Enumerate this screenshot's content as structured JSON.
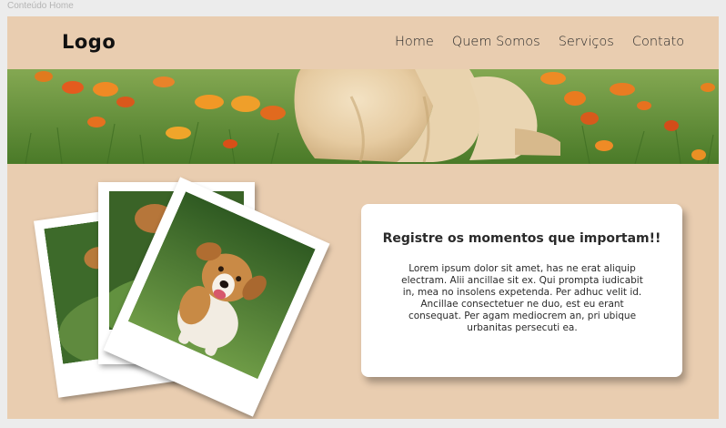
{
  "frame": {
    "label": "Conteúdo Home"
  },
  "header": {
    "logo": "Logo",
    "nav": [
      {
        "label": "Home"
      },
      {
        "label": "Quem Somos"
      },
      {
        "label": "Serviços"
      },
      {
        "label": "Contato"
      }
    ]
  },
  "card": {
    "title": "Registre os momentos que importam!!",
    "body": "Lorem ipsum dolor sit amet, has ne erat aliquip electram. Alii ancillae sit ex. Qui prompta iudicabit in, mea no insolens expetenda. Per adhuc velit id. Ancillae consectetuer ne duo, est eu erant consequat. Per agam mediocrem an, pri ubique urbanitas persecuti ea."
  },
  "colors": {
    "page_background": "#e9cdb0",
    "canvas_background": "#ececec",
    "card_background": "#ffffff",
    "text": "#2a2a2a"
  },
  "icons": [
    "banner-puppy-image",
    "polaroid-dog-photo"
  ]
}
